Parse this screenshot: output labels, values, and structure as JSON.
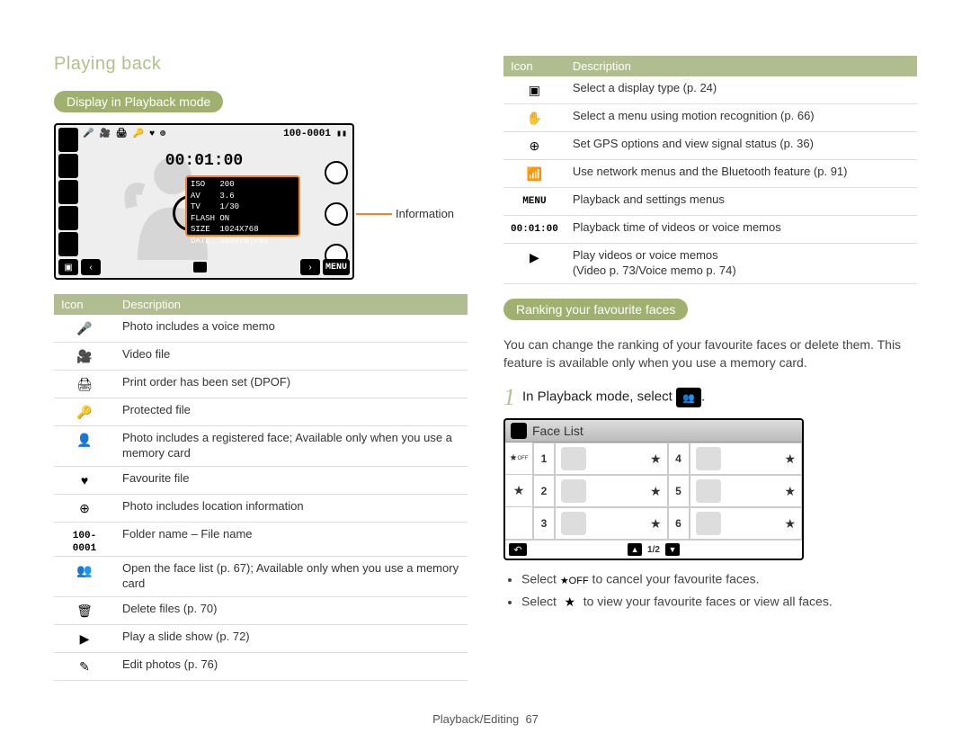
{
  "breadcrumb": "Playing back",
  "left": {
    "heading": "Display in Playback mode",
    "screen": {
      "playback_time": "00:01:00",
      "folder_file": "100-0001",
      "info_lines": [
        "ISO   200",
        "AV    3.6",
        "TV    1/30",
        "FLASH ON",
        "SIZE  1024X768",
        "DATE  2009/07/01"
      ],
      "info_label": "Information",
      "menu_label": "MENU"
    },
    "table": {
      "headers": {
        "icon": "Icon",
        "desc": "Description"
      },
      "rows": [
        {
          "icon": "voice-memo-icon",
          "glyph": "🎤",
          "desc": "Photo includes a voice memo"
        },
        {
          "icon": "video-file-icon",
          "glyph": "🎥",
          "desc": "Video file"
        },
        {
          "icon": "print-order-icon",
          "glyph": "🖨",
          "desc": "Print order has been set (DPOF)"
        },
        {
          "icon": "protected-file-icon",
          "glyph": "🔑",
          "desc": "Protected file"
        },
        {
          "icon": "registered-face-icon",
          "glyph": "👤",
          "desc": "Photo includes a registered face; Available only when you use a memory card"
        },
        {
          "icon": "favourite-file-icon",
          "glyph": "♥",
          "desc": "Favourite file"
        },
        {
          "icon": "location-info-icon",
          "glyph": "⊕",
          "desc": "Photo includes location information"
        },
        {
          "icon": "folder-file-icon",
          "glyph": "100-0001",
          "is_mono": true,
          "desc": "Folder name – File name"
        },
        {
          "icon": "face-list-icon",
          "glyph": "👥",
          "desc": "Open the face list (p. 67); Available only when you use a memory card"
        },
        {
          "icon": "delete-icon",
          "glyph": "🗑",
          "desc": "Delete files (p. 70)"
        },
        {
          "icon": "slideshow-icon",
          "glyph": "▶",
          "desc": "Play a slide show (p. 72)"
        },
        {
          "icon": "edit-photos-icon",
          "glyph": "✎",
          "desc": "Edit photos (p. 76)"
        }
      ]
    }
  },
  "right": {
    "table": {
      "headers": {
        "icon": "Icon",
        "desc": "Description"
      },
      "rows": [
        {
          "icon": "display-type-icon",
          "glyph": "▣",
          "desc": "Select a display type (p. 24)"
        },
        {
          "icon": "motion-menu-icon",
          "glyph": "✋",
          "desc": "Select a menu using motion recognition (p. 66)"
        },
        {
          "icon": "gps-icon",
          "glyph": "⊕",
          "desc": "Set GPS options and view signal status (p. 36)"
        },
        {
          "icon": "network-icon",
          "glyph": "📶",
          "desc": "Use network menus and the Bluetooth feature (p. 91)"
        },
        {
          "icon": "menu-icon",
          "glyph": "MENU",
          "is_mono": true,
          "desc": "Playback and settings menus"
        },
        {
          "icon": "playback-time-icon",
          "glyph": "00:01:00",
          "is_mono": true,
          "desc": "Playback time of videos or voice memos"
        },
        {
          "icon": "play-icon",
          "glyph": "▶",
          "desc": "Play videos or voice memos\n(Video p. 73/Voice memo p. 74)"
        }
      ]
    },
    "heading": "Ranking your favourite faces",
    "paragraph": "You can change the ranking of your favourite faces or delete them. This feature is available only when you use a memory card.",
    "step": {
      "num": "1",
      "text": "In Playback mode, select",
      "trailing_icon": "face-list-icon",
      "trailing_glyph": "👥",
      "period": "."
    },
    "facelist": {
      "title": "Face List",
      "cells": [
        "1",
        "2",
        "3",
        "4",
        "5",
        "6"
      ],
      "page": "1/2"
    },
    "bullets": [
      {
        "pre": "Select ",
        "glyph": "★OFF",
        "icon": "star-off-icon",
        "post": " to cancel your favourite faces."
      },
      {
        "pre": "Select ",
        "glyph": "★",
        "icon": "star-icon",
        "post": " to view your favourite faces or view all faces."
      }
    ]
  },
  "footer": {
    "section": "Playback/Editing",
    "page": "67"
  }
}
